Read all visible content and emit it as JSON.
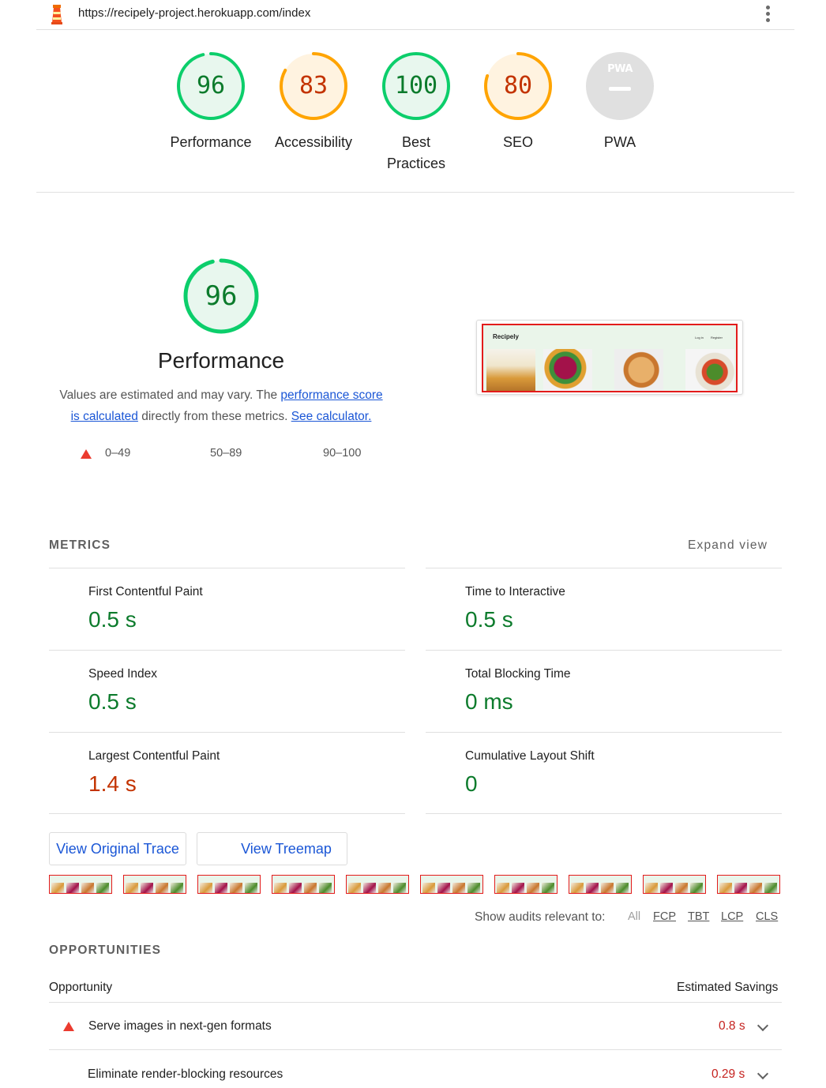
{
  "browser": {
    "url": "https://recipely-project.herokuapp.com/index"
  },
  "category_scores": [
    {
      "label_line1": "Performance",
      "label_line2": "",
      "score": "96",
      "fraction": 0.96,
      "status": "pass",
      "color": "#0cce6b",
      "text_color": "#0c7b2c",
      "bg": "#e8f7ee"
    },
    {
      "label_line1": "Accessibility",
      "label_line2": "",
      "score": "83",
      "fraction": 0.83,
      "status": "average",
      "color": "#ffa400",
      "text_color": "#c33300",
      "bg": "#fff3e0"
    },
    {
      "label_line1": "Best",
      "label_line2": "Practices",
      "score": "100",
      "fraction": 1.0,
      "status": "pass",
      "color": "#0cce6b",
      "text_color": "#0c7b2c",
      "bg": "#e8f7ee"
    },
    {
      "label_line1": "SEO",
      "label_line2": "",
      "score": "80",
      "fraction": 0.8,
      "status": "average",
      "color": "#ffa400",
      "text_color": "#c33300",
      "bg": "#fff3e0"
    },
    {
      "label_line1": "PWA",
      "label_line2": "",
      "score": "",
      "fraction": 0,
      "status": "na",
      "color": "#e0e0e0",
      "text_color": "#ffffff",
      "bg": "#e0e0e0",
      "badge_text": "PWA"
    }
  ],
  "performance": {
    "score": "96",
    "fraction": 0.96,
    "title": "Performance",
    "desc_part1": "Values are estimated and may vary. The ",
    "desc_link1a": "performance score",
    "desc_link1b": "is calculated",
    "desc_part2": " directly from these metrics. ",
    "desc_link2": "See calculator.",
    "legend": [
      "0–49",
      "50–89",
      "90–100"
    ]
  },
  "screenshot_preview": {
    "brand": "Recipely",
    "nav_login": "Log in",
    "nav_register": "Register"
  },
  "metrics": {
    "heading": "METRICS",
    "expand_label": "Expand view",
    "items": [
      {
        "label": "First Contentful Paint",
        "value": "0.5 s",
        "status": "pass"
      },
      {
        "label": "Time to Interactive",
        "value": "0.5 s",
        "status": "pass"
      },
      {
        "label": "Speed Index",
        "value": "0.5 s",
        "status": "pass"
      },
      {
        "label": "Total Blocking Time",
        "value": "0 ms",
        "status": "pass"
      },
      {
        "label": "Largest Contentful Paint",
        "value": "1.4 s",
        "status": "fail"
      },
      {
        "label": "Cumulative Layout Shift",
        "value": "0",
        "status": "pass"
      }
    ]
  },
  "buttons": {
    "view_trace": "View Original Trace",
    "view_treemap": "View Treemap"
  },
  "audit_filter": {
    "label": "Show audits relevant to:",
    "options": [
      "All",
      "FCP",
      "TBT",
      "LCP",
      "CLS"
    ]
  },
  "opportunities": {
    "heading": "OPPORTUNITIES",
    "col_opportunity": "Opportunity",
    "col_savings": "Estimated Savings",
    "items": [
      {
        "label": "Serve images in next-gen formats",
        "savings": "0.8 s",
        "status": "fail"
      },
      {
        "label": "Eliminate render-blocking resources",
        "savings": "0.29 s",
        "status": "average"
      }
    ]
  },
  "colors": {
    "pass": "#0cce6b",
    "average": "#ffa400",
    "fail": "#ff4e42",
    "link": "#1a56d6"
  }
}
